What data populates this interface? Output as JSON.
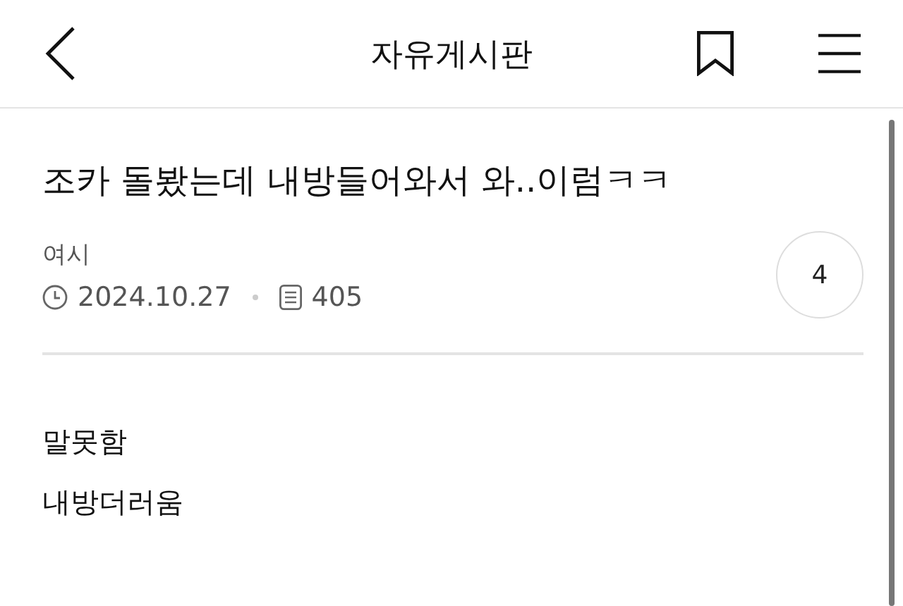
{
  "header": {
    "title": "자유게시판"
  },
  "post": {
    "title": "조카 돌봤는데 내방들어와서 와..이럼ㅋㅋ",
    "author": "여시",
    "date": "2024.10.27",
    "views": "405",
    "comment_count": "4",
    "body": [
      "말못함",
      "내방더러움"
    ]
  }
}
